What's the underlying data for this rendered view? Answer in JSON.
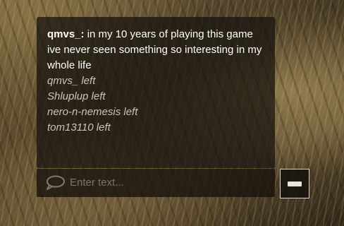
{
  "chat": {
    "message": {
      "author": "qmvs_:",
      "text": "in my 10 years of playing this game ive never seen something so interesting in my whole life"
    },
    "system_messages": [
      "qmvs_ left",
      "Shluplup left",
      "nero-n-nemesis left",
      "tom13110 left"
    ]
  },
  "input": {
    "placeholder": "Enter text...",
    "icon": "chat-bubble-icon"
  },
  "side_button": {
    "icon": "keyboard-icon"
  }
}
